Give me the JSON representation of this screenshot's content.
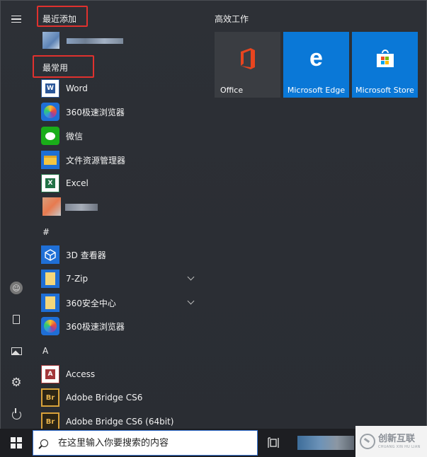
{
  "sections": {
    "recently_added": "最近添加",
    "most_used": "最常用",
    "hash": "#",
    "letter_a": "A"
  },
  "most_used_items": [
    {
      "label": "Word",
      "icon": "word-icon"
    },
    {
      "label": "360极速浏览器",
      "icon": "360-browser-icon"
    },
    {
      "label": "微信",
      "icon": "wechat-icon"
    },
    {
      "label": "文件资源管理器",
      "icon": "file-explorer-icon"
    },
    {
      "label": "Excel",
      "icon": "excel-icon"
    }
  ],
  "hash_items": [
    {
      "label": "3D 查看器",
      "icon": "3d-viewer-icon"
    },
    {
      "label": "7-Zip",
      "icon": "folder-icon",
      "expandable": true
    },
    {
      "label": "360安全中心",
      "icon": "folder-icon",
      "expandable": true
    },
    {
      "label": "360极速浏览器",
      "icon": "360-browser-icon"
    }
  ],
  "a_items": [
    {
      "label": "Access",
      "icon": "access-icon"
    },
    {
      "label": "Adobe Bridge CS6",
      "icon": "adobe-bridge-icon"
    },
    {
      "label": "Adobe Bridge CS6 (64bit)",
      "icon": "adobe-bridge-icon"
    }
  ],
  "tiles": {
    "group_title": "高效工作",
    "items": [
      {
        "label": "Office",
        "icon": "office-icon",
        "bg": "#3a3d42"
      },
      {
        "label": "Microsoft Edge",
        "icon": "edge-icon",
        "bg": "#0a78d7"
      },
      {
        "label": "Microsoft Store",
        "icon": "store-icon",
        "bg": "#0a78d7"
      }
    ]
  },
  "taskbar": {
    "search_placeholder": "在这里输入你要搜索的内容"
  },
  "watermark": {
    "text": "创新互联",
    "sub": "CHUANG XIN HU LIAN"
  },
  "colors": {
    "highlight_box": "#e0312e",
    "tile_blue": "#0a78d7",
    "background": "#2b2e34"
  }
}
